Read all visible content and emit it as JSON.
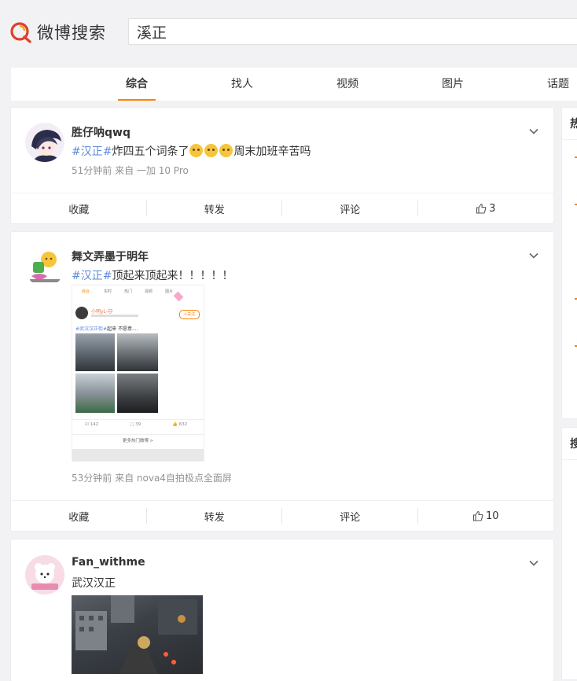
{
  "logo": {
    "text": "微博搜索"
  },
  "search": {
    "value": "溪正"
  },
  "tabs": [
    {
      "label": "综合",
      "active": true
    },
    {
      "label": "找人",
      "active": false
    },
    {
      "label": "视频",
      "active": false
    },
    {
      "label": "图片",
      "active": false
    },
    {
      "label": "话题",
      "active": false
    }
  ],
  "sidebar": {
    "box1_title": "热",
    "box2_title": "搜"
  },
  "posts": [
    {
      "name": "胜仔呐qwq",
      "topic": "#汉正#",
      "text_before": "炸四五个词条了",
      "text_after": "周末加班辛苦吗",
      "meta": "51分钟前  来自 一加 10 Pro",
      "actions": {
        "collect": "收藏",
        "forward": "转发",
        "comment": "评论",
        "likes": "3"
      }
    },
    {
      "name": "舞文弄墨于明年",
      "topic": "#汉正#",
      "text": "顶起来顶起来！！！！！",
      "meta": "53分钟前  来自 nova4自拍极点全面屏",
      "actions": {
        "collect": "收藏",
        "forward": "转发",
        "comment": "评论",
        "likes": "10"
      },
      "embedded": {
        "tabs": [
          "综合",
          "实时",
          "热门",
          "视频",
          "图片"
        ],
        "user": "小明yL-🐱",
        "follow": "+关注",
        "topic": "#武汉汉正街#",
        "text": "起来 不愿意....",
        "reposts": "142",
        "comments": "39",
        "likes": "632",
        "more": "更多热门微博 >"
      }
    },
    {
      "name": "Fan_withme",
      "text": "武汉汉正",
      "meta": "",
      "actions": {}
    }
  ]
}
